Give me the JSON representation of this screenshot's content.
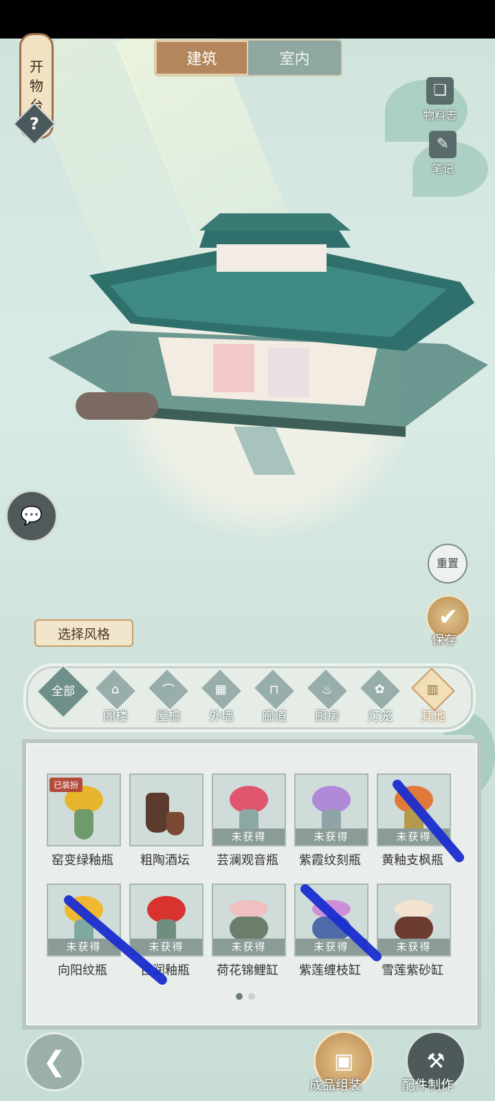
{
  "left_lantern": {
    "text": [
      "开",
      "物",
      "台"
    ]
  },
  "help_icon_text": "?",
  "tabs": [
    {
      "label": "建筑",
      "active": true
    },
    {
      "label": "室内",
      "active": false
    }
  ],
  "right_buttons": [
    {
      "label": "物料志",
      "icon": "book-icon"
    },
    {
      "label": "笔记",
      "icon": "notebook-icon"
    }
  ],
  "reset": {
    "label": "重置"
  },
  "save": {
    "label": "保存",
    "icon": "check-icon"
  },
  "style_button": {
    "label": "选择风格"
  },
  "categories": [
    {
      "label": "全部",
      "icon": "all-icon",
      "active": false
    },
    {
      "label": "阁楼",
      "icon": "attic-icon",
      "active": false
    },
    {
      "label": "屋檐",
      "icon": "eaves-icon",
      "active": false
    },
    {
      "label": "外墙",
      "icon": "wall-icon",
      "active": false
    },
    {
      "label": "廊道",
      "icon": "corridor-icon",
      "active": false
    },
    {
      "label": "厨房",
      "icon": "kitchen-icon",
      "active": false
    },
    {
      "label": "灯笼",
      "icon": "lantern-icon",
      "active": false
    },
    {
      "label": "其他",
      "icon": "other-icon",
      "active": true
    }
  ],
  "items": [
    {
      "name": "窑变绿釉瓶",
      "status": "已装扮",
      "bloom_color": "#e7b52b",
      "pot_color": "#6f9a6c"
    },
    {
      "name": "粗陶酒坛",
      "status": "",
      "bloom_color": "",
      "pot_color": "#5b3b2e"
    },
    {
      "name": "芸澜观音瓶",
      "status": "未获得",
      "bloom_color": "#e0566f",
      "pot_color": "#8aa8a4"
    },
    {
      "name": "紫霞纹刻瓶",
      "status": "未获得",
      "bloom_color": "#b08ad8",
      "pot_color": "#8ea4a6"
    },
    {
      "name": "黄釉支枫瓶",
      "status": "未获得",
      "bloom_color": "#e07a3a",
      "pot_color": "#b59a4d"
    },
    {
      "name": "向阳纹瓶",
      "status": "未获得",
      "bloom_color": "#f0b830",
      "pot_color": "#7fa8a0"
    },
    {
      "name": "古润釉瓶",
      "status": "未获得",
      "bloom_color": "#d8332f",
      "pot_color": "#6e8f7e"
    },
    {
      "name": "荷花锦鲤缸",
      "status": "未获得",
      "bloom_color": "#f0c0c0",
      "pot_color": "#6b7d6b"
    },
    {
      "name": "紫莲缠枝缸",
      "status": "未获得",
      "bloom_color": "#cf8fd6",
      "pot_color": "#4e6aa8"
    },
    {
      "name": "雪莲紫砂缸",
      "status": "未获得",
      "bloom_color": "#f2e4d0",
      "pot_color": "#6b3c2e"
    }
  ],
  "pagination": {
    "current": 1,
    "total": 2
  },
  "bottom": {
    "back_icon": "back-arrow-icon",
    "assemble_label": "成品组装",
    "craft_label": "配件制作"
  },
  "annotations": {
    "strokes": 3,
    "color": "#1a2fd0"
  }
}
